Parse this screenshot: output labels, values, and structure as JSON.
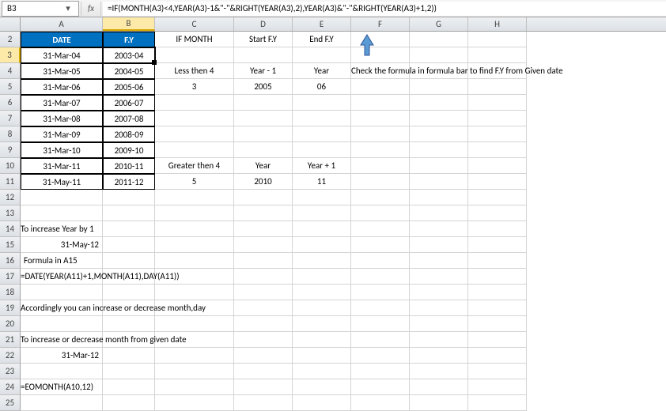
{
  "nameBox": "B3",
  "fxLabel": "fx",
  "formula": "=IF(MONTH(A3)<4,YEAR(A3)-1&\"-\"&RIGHT(YEAR(A3),2),YEAR(A3)&\"-\"&RIGHT(YEAR(A3)+1,2))",
  "columns": [
    "A",
    "B",
    "C",
    "D",
    "E",
    "F",
    "G",
    "H"
  ],
  "headers": {
    "A": "DATE",
    "B": "F.Y",
    "C": "IF MONTH",
    "D": "Start F.Y",
    "E": "End F.Y"
  },
  "tableRows": [
    {
      "date": "31-Mar-04",
      "fy": "2003-04"
    },
    {
      "date": "31-Mar-05",
      "fy": "2004-05"
    },
    {
      "date": "31-Mar-06",
      "fy": "2005-06"
    },
    {
      "date": "31-Mar-07",
      "fy": "2006-07"
    },
    {
      "date": "31-Mar-08",
      "fy": "2007-08"
    },
    {
      "date": "31-Mar-09",
      "fy": "2008-09"
    },
    {
      "date": "31-Mar-10",
      "fy": "2009-10"
    },
    {
      "date": "31-Mar-11",
      "fy": "2010-11"
    },
    {
      "date": "31-May-11",
      "fy": "2011-12"
    }
  ],
  "logic": {
    "lessThan4": {
      "C": "Less then 4",
      "D": "Year - 1",
      "E": "Year"
    },
    "lessExample": {
      "C": "3",
      "D": "2005",
      "E": "06"
    },
    "greaterThan4": {
      "C": "Greater then 4",
      "D": "Year",
      "E": "Year + 1"
    },
    "greaterExample": {
      "C": "5",
      "D": "2010",
      "E": "11"
    }
  },
  "checkNote": "Check the formula in formula bar to find F.Y from Given date",
  "notes": {
    "r14": "To increase Year by 1",
    "r15": "31-May-12",
    "r16": "Formula in A15",
    "r17": "=DATE(YEAR(A11)+1,MONTH(A11),DAY(A11))",
    "r19": "Accordingly you can increase or decrease  month,day",
    "r21": "To increase or decrease month from given date",
    "r22": "31-Mar-12",
    "r24": "=EOMONTH(A10,12)"
  },
  "rowNumbers": [
    2,
    3,
    4,
    5,
    6,
    7,
    8,
    9,
    10,
    11,
    12,
    13,
    14,
    15,
    16,
    17,
    18,
    19,
    20,
    21,
    22,
    23,
    24,
    25
  ]
}
